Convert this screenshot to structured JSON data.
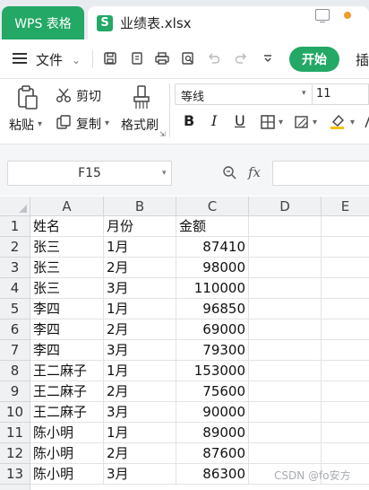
{
  "tabs": {
    "app_label": "WPS 表格",
    "file_icon_letter": "S",
    "file_name": "业绩表.xlsx"
  },
  "menu": {
    "file_label": "文件",
    "start_label": "开始",
    "insert_label": "插",
    "icons": [
      "save-icon",
      "export-pdf-icon",
      "print-icon",
      "print-preview-icon",
      "undo-icon",
      "redo-icon",
      "more-icon"
    ]
  },
  "ribbon": {
    "paste_label": "粘贴",
    "cut_label": "剪切",
    "copy_label": "复制",
    "format_painter_label": "格式刷",
    "font_name": "等线",
    "font_size": "11",
    "bold": "B",
    "italic": "I",
    "underline": "U"
  },
  "formula_bar": {
    "cell_ref": "F15",
    "fx": "fx"
  },
  "sheet": {
    "columns": [
      "A",
      "B",
      "C",
      "D",
      "E"
    ],
    "rows": [
      {
        "num": "1",
        "a": "姓名",
        "b": "月份",
        "c": "金额"
      },
      {
        "num": "2",
        "a": "张三",
        "b": "1月",
        "c": "87410"
      },
      {
        "num": "3",
        "a": "张三",
        "b": "2月",
        "c": "98000"
      },
      {
        "num": "4",
        "a": "张三",
        "b": "3月",
        "c": "110000"
      },
      {
        "num": "5",
        "a": "李四",
        "b": "1月",
        "c": "96850"
      },
      {
        "num": "6",
        "a": "李四",
        "b": "2月",
        "c": "69000"
      },
      {
        "num": "7",
        "a": "李四",
        "b": "3月",
        "c": "79300"
      },
      {
        "num": "8",
        "a": "王二麻子",
        "b": "1月",
        "c": "153000"
      },
      {
        "num": "9",
        "a": "王二麻子",
        "b": "2月",
        "c": "75600"
      },
      {
        "num": "10",
        "a": "王二麻子",
        "b": "3月",
        "c": "90000"
      },
      {
        "num": "11",
        "a": "陈小明",
        "b": "1月",
        "c": "89000"
      },
      {
        "num": "12",
        "a": "陈小明",
        "b": "2月",
        "c": "87600"
      },
      {
        "num": "13",
        "a": "陈小明",
        "b": "3月",
        "c": "86300"
      }
    ]
  },
  "watermark": "CSDN @fo安方",
  "colors": {
    "accent": "#23a866",
    "tabbar_bg": "#e8ebef",
    "status_dot": "#f29a2e"
  }
}
